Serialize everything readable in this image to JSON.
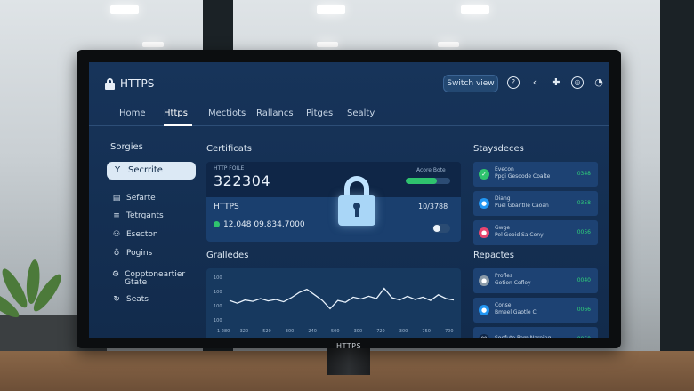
{
  "header": {
    "brand_title": "HTTPS",
    "switch_button": "Switch view"
  },
  "nav": {
    "items": [
      "Home",
      "Https",
      "Mectiots",
      "Rallancs",
      "Pitges",
      "Sealty"
    ],
    "active_index": 1
  },
  "sidebar": {
    "title": "Sorgies",
    "active_item": "Secrrite",
    "items": [
      "Sefarte",
      "Tetrgants",
      "Esecton",
      "Pogins",
      "Copptoneartier Gtate",
      "Seats"
    ]
  },
  "certificate": {
    "section_title": "Certificats",
    "head_small_label": "HTTP FOILE",
    "big_number": "322304",
    "status_small_label": "Acore Bote",
    "progress_percent": 70,
    "row_label": "HTTPS",
    "row_value": "10/3788",
    "address": "12.048 09.834.7000",
    "toggle_on": false
  },
  "chart_section": {
    "title": "Gralledes"
  },
  "chart_data": {
    "type": "line",
    "x_tick_labels": [
      "1 280",
      "320",
      "520",
      "300",
      "240",
      "500",
      "300",
      "720",
      "300",
      "750",
      "700"
    ],
    "y_tick_labels": [
      "100",
      "100",
      "100",
      "100"
    ],
    "values": [
      46,
      40,
      47,
      44,
      50,
      45,
      48,
      43,
      52,
      63,
      70,
      58,
      46,
      28,
      46,
      42,
      53,
      49,
      55,
      50,
      72,
      52,
      47,
      55,
      48,
      53,
      46,
      58,
      50,
      47
    ],
    "ylim": [
      0,
      100
    ],
    "grid": false,
    "line_color": "#e8f2fc"
  },
  "right_top": {
    "title": "Staysdeces",
    "rows": [
      {
        "line1": "Evecon",
        "line2": "Ppgi Gesoode Coalte",
        "value": "0348",
        "icon_color": "#2fc36e",
        "icon": "✓"
      },
      {
        "line1": "Diang",
        "line2": "Puel Gbantlle Caoan",
        "value": "0358",
        "icon_color": "#2196f3",
        "icon": "●"
      },
      {
        "line1": "Gwge",
        "line2": "Pel Gooid Sa Cony",
        "value": "0056",
        "icon_color": "#e8456f",
        "icon": "●"
      }
    ]
  },
  "right_bottom": {
    "title": "Repactes",
    "rows": [
      {
        "line1": "Profles",
        "line2": "Gotion Cofley",
        "value": "0040",
        "icon_color": "#8a9aa8",
        "icon": "●"
      },
      {
        "line1": "Conse",
        "line2": "Bmeel Gaotle C",
        "value": "0066",
        "icon_color": "#2196f3",
        "icon": "●"
      },
      {
        "line1": "",
        "line2": "Soofute Pam Nareing",
        "value": "0050",
        "icon_color": "#0f2647",
        "icon": "⌘"
      }
    ]
  },
  "monitor": {
    "bezel_label": "HTTPS"
  },
  "icons": {
    "brand": "lock-icon",
    "top": [
      "help-icon",
      "back-icon",
      "pin-icon",
      "globe-icon",
      "chat-icon"
    ]
  }
}
